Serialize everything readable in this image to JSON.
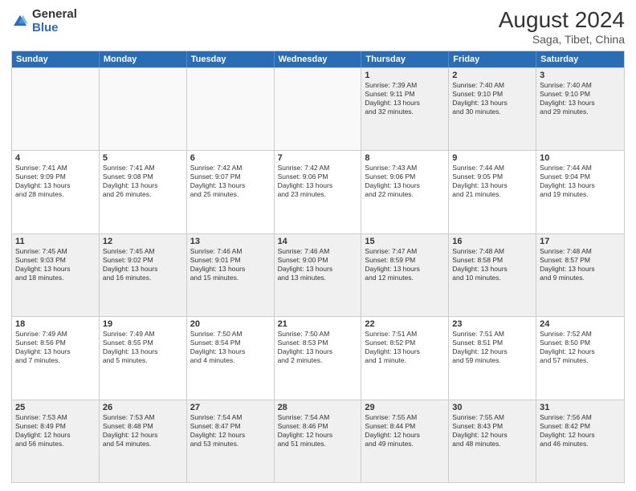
{
  "logo": {
    "general": "General",
    "blue": "Blue"
  },
  "title": "August 2024",
  "subtitle": "Saga, Tibet, China",
  "header_days": [
    "Sunday",
    "Monday",
    "Tuesday",
    "Wednesday",
    "Thursday",
    "Friday",
    "Saturday"
  ],
  "weeks": [
    [
      {
        "day": "",
        "info": "",
        "empty": true
      },
      {
        "day": "",
        "info": "",
        "empty": true
      },
      {
        "day": "",
        "info": "",
        "empty": true
      },
      {
        "day": "",
        "info": "",
        "empty": true
      },
      {
        "day": "1",
        "info": "Sunrise: 7:39 AM\nSunset: 9:11 PM\nDaylight: 13 hours\nand 32 minutes."
      },
      {
        "day": "2",
        "info": "Sunrise: 7:40 AM\nSunset: 9:10 PM\nDaylight: 13 hours\nand 30 minutes."
      },
      {
        "day": "3",
        "info": "Sunrise: 7:40 AM\nSunset: 9:10 PM\nDaylight: 13 hours\nand 29 minutes."
      }
    ],
    [
      {
        "day": "4",
        "info": "Sunrise: 7:41 AM\nSunset: 9:09 PM\nDaylight: 13 hours\nand 28 minutes."
      },
      {
        "day": "5",
        "info": "Sunrise: 7:41 AM\nSunset: 9:08 PM\nDaylight: 13 hours\nand 26 minutes."
      },
      {
        "day": "6",
        "info": "Sunrise: 7:42 AM\nSunset: 9:07 PM\nDaylight: 13 hours\nand 25 minutes."
      },
      {
        "day": "7",
        "info": "Sunrise: 7:42 AM\nSunset: 9:06 PM\nDaylight: 13 hours\nand 23 minutes."
      },
      {
        "day": "8",
        "info": "Sunrise: 7:43 AM\nSunset: 9:06 PM\nDaylight: 13 hours\nand 22 minutes."
      },
      {
        "day": "9",
        "info": "Sunrise: 7:44 AM\nSunset: 9:05 PM\nDaylight: 13 hours\nand 21 minutes."
      },
      {
        "day": "10",
        "info": "Sunrise: 7:44 AM\nSunset: 9:04 PM\nDaylight: 13 hours\nand 19 minutes."
      }
    ],
    [
      {
        "day": "11",
        "info": "Sunrise: 7:45 AM\nSunset: 9:03 PM\nDaylight: 13 hours\nand 18 minutes."
      },
      {
        "day": "12",
        "info": "Sunrise: 7:45 AM\nSunset: 9:02 PM\nDaylight: 13 hours\nand 16 minutes."
      },
      {
        "day": "13",
        "info": "Sunrise: 7:46 AM\nSunset: 9:01 PM\nDaylight: 13 hours\nand 15 minutes."
      },
      {
        "day": "14",
        "info": "Sunrise: 7:46 AM\nSunset: 9:00 PM\nDaylight: 13 hours\nand 13 minutes."
      },
      {
        "day": "15",
        "info": "Sunrise: 7:47 AM\nSunset: 8:59 PM\nDaylight: 13 hours\nand 12 minutes."
      },
      {
        "day": "16",
        "info": "Sunrise: 7:48 AM\nSunset: 8:58 PM\nDaylight: 13 hours\nand 10 minutes."
      },
      {
        "day": "17",
        "info": "Sunrise: 7:48 AM\nSunset: 8:57 PM\nDaylight: 13 hours\nand 9 minutes."
      }
    ],
    [
      {
        "day": "18",
        "info": "Sunrise: 7:49 AM\nSunset: 8:56 PM\nDaylight: 13 hours\nand 7 minutes."
      },
      {
        "day": "19",
        "info": "Sunrise: 7:49 AM\nSunset: 8:55 PM\nDaylight: 13 hours\nand 5 minutes."
      },
      {
        "day": "20",
        "info": "Sunrise: 7:50 AM\nSunset: 8:54 PM\nDaylight: 13 hours\nand 4 minutes."
      },
      {
        "day": "21",
        "info": "Sunrise: 7:50 AM\nSunset: 8:53 PM\nDaylight: 13 hours\nand 2 minutes."
      },
      {
        "day": "22",
        "info": "Sunrise: 7:51 AM\nSunset: 8:52 PM\nDaylight: 13 hours\nand 1 minute."
      },
      {
        "day": "23",
        "info": "Sunrise: 7:51 AM\nSunset: 8:51 PM\nDaylight: 12 hours\nand 59 minutes."
      },
      {
        "day": "24",
        "info": "Sunrise: 7:52 AM\nSunset: 8:50 PM\nDaylight: 12 hours\nand 57 minutes."
      }
    ],
    [
      {
        "day": "25",
        "info": "Sunrise: 7:53 AM\nSunset: 8:49 PM\nDaylight: 12 hours\nand 56 minutes."
      },
      {
        "day": "26",
        "info": "Sunrise: 7:53 AM\nSunset: 8:48 PM\nDaylight: 12 hours\nand 54 minutes."
      },
      {
        "day": "27",
        "info": "Sunrise: 7:54 AM\nSunset: 8:47 PM\nDaylight: 12 hours\nand 53 minutes."
      },
      {
        "day": "28",
        "info": "Sunrise: 7:54 AM\nSunset: 8:46 PM\nDaylight: 12 hours\nand 51 minutes."
      },
      {
        "day": "29",
        "info": "Sunrise: 7:55 AM\nSunset: 8:44 PM\nDaylight: 12 hours\nand 49 minutes."
      },
      {
        "day": "30",
        "info": "Sunrise: 7:55 AM\nSunset: 8:43 PM\nDaylight: 12 hours\nand 48 minutes."
      },
      {
        "day": "31",
        "info": "Sunrise: 7:56 AM\nSunset: 8:42 PM\nDaylight: 12 hours\nand 46 minutes."
      }
    ]
  ]
}
